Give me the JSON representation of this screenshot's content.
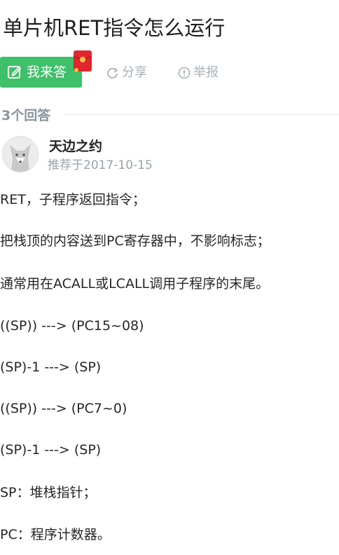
{
  "question": {
    "title": "单片机RET指令怎么运行"
  },
  "actions": {
    "answer_label": "我来答",
    "share_label": "分享",
    "report_label": "举报"
  },
  "answers_header": {
    "count_label": "3个回答"
  },
  "answer": {
    "author_name": "天边之约",
    "recommend_text": "推荐于2017-10-15",
    "lines": [
      "RET，子程序返回指令；",
      "把栈顶的内容送到PC寄存器中，不影响标志；",
      "通常用在ACALL或LCALL调用子程序的末尾。",
      "((SP)) ---> (PC15~08)",
      "(SP)-1 ---> (SP)",
      "((SP)) ---> (PC7~0)",
      "(SP)-1 ---> (SP)",
      "SP：堆栈指针；",
      "PC：程序计数器。"
    ]
  },
  "icons": {
    "edit": "edit-icon",
    "redpacket": "red-envelope-icon",
    "share": "share-icon",
    "report": "report-icon"
  },
  "colors": {
    "answer_button": "#3fc06a",
    "muted_text": "#a9b1b8",
    "red_envelope": "#e0262e"
  }
}
